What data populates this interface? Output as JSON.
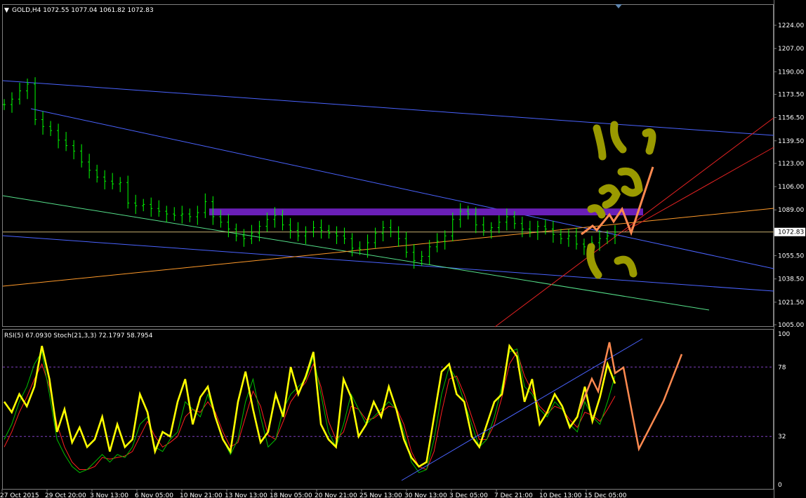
{
  "colors": {
    "background": "#000000",
    "frame": "#7f7f7f",
    "bull_bars": "#00ff00",
    "rsi": "#ffff00",
    "stoch_main": "#00c000",
    "stoch_signal": "#ff2020",
    "channel_blue": "#4a63ff",
    "channel_red": "#e52222",
    "trend_orange": "#ff9a2a",
    "trend_green": "#55e08a",
    "zone_purple": "#6a1fb8",
    "hand_orange": "#ff8a50",
    "hand_yellow": "#9a9a00",
    "price_tag_bg": "#ffffff"
  },
  "header": {
    "arrow": "▼",
    "title": "GOLD,H4  1072.55 1077.04 1061.82 1072.83"
  },
  "indicator_header": {
    "title": "RSI(5) 67.0930  Stoch(21,3,3) 72.1797 58.7954"
  },
  "current_price_label": "1072.83",
  "price_scale": [
    "1224.00",
    "1207.00",
    "1190.00",
    "1173.50",
    "1156.50",
    "1139.50",
    "1123.00",
    "1106.00",
    "1089.00",
    "1072.83",
    "1055.50",
    "1038.50",
    "1021.50",
    "1005.00"
  ],
  "oscillator_scale": [
    "100",
    "78",
    "32",
    "0"
  ],
  "time_labels": [
    "27 Oct 2015",
    "29 Oct 20:00",
    "3 Nov 13:00",
    "6 Nov 05:00",
    "10 Nov 21:00",
    "13 Nov 13:00",
    "18 Nov 05:00",
    "20 Nov 21:00",
    "25 Nov 13:00",
    "30 Nov 13:00",
    "3 Dec 05:00",
    "7 Dec 21:00",
    "10 Dec 13:00",
    "15 Dec 05:00"
  ],
  "chart_data": [
    {
      "type": "candlestick",
      "symbol": "GOLD",
      "timeframe": "H4",
      "ohlc_last": {
        "open": 1072.55,
        "high": 1077.04,
        "low": 1061.82,
        "close": 1072.83
      },
      "ylim": [
        1005.0,
        1234.0
      ],
      "x": [
        "27 Oct 2015",
        "29 Oct 20:00",
        "3 Nov 13:00",
        "6 Nov 05:00",
        "10 Nov 21:00",
        "13 Nov 13:00",
        "18 Nov 05:00",
        "20 Nov 21:00",
        "25 Nov 13:00",
        "30 Nov 13:00",
        "3 Dec 05:00",
        "7 Dec 21:00",
        "10 Dec 13:00",
        "15 Dec 05:00"
      ],
      "close_path": [
        1166,
        1170,
        1176,
        1181,
        1155,
        1150,
        1147,
        1140,
        1136,
        1132,
        1124,
        1118,
        1113,
        1110,
        1108,
        1109,
        1094,
        1092,
        1093,
        1090,
        1088,
        1086,
        1085,
        1086,
        1084,
        1087,
        1095,
        1084,
        1080,
        1075,
        1070,
        1068,
        1072,
        1077,
        1082,
        1085,
        1078,
        1074,
        1070,
        1073,
        1076,
        1074,
        1072,
        1070,
        1068,
        1061,
        1060,
        1065,
        1072,
        1076,
        1073,
        1068,
        1058,
        1052,
        1055,
        1062,
        1066,
        1070,
        1082,
        1088,
        1086,
        1078,
        1074,
        1076,
        1080,
        1084,
        1079,
        1075,
        1073,
        1077,
        1075,
        1071,
        1068,
        1070,
        1064,
        1062,
        1065,
        1068,
        1070,
        1072.83
      ],
      "levels": {
        "resistance_zone": [
          1085,
          1090
        ],
        "current": 1072.83
      }
    },
    {
      "type": "line",
      "title": "RSI(5) 67.0930  Stoch(21,3,3) 72.1797 58.7954",
      "ylim": [
        0,
        100
      ],
      "levels": [
        78,
        32
      ],
      "series": [
        {
          "name": "RSI(5)",
          "values": [
            55,
            48,
            60,
            52,
            65,
            92,
            70,
            35,
            50,
            28,
            38,
            25,
            30,
            45,
            22,
            40,
            25,
            30,
            60,
            48,
            22,
            35,
            32,
            55,
            70,
            40,
            58,
            65,
            45,
            30,
            22,
            55,
            75,
            50,
            28,
            35,
            60,
            45,
            78,
            60,
            72,
            88,
            40,
            30,
            25,
            70,
            58,
            32,
            40,
            55,
            45,
            65,
            50,
            30,
            18,
            12,
            15,
            45,
            75,
            80,
            60,
            55,
            32,
            25,
            40,
            55,
            60,
            92,
            85,
            55,
            70,
            40,
            48,
            60,
            52,
            38,
            45,
            65,
            42,
            58,
            80,
            67.09
          ]
        },
        {
          "name": "Stoch(21,3,3) main",
          "values": [
            30,
            40,
            55,
            65,
            80,
            88,
            60,
            30,
            20,
            12,
            8,
            10,
            15,
            20,
            15,
            20,
            18,
            25,
            40,
            45,
            25,
            22,
            30,
            35,
            55,
            50,
            45,
            60,
            45,
            30,
            20,
            30,
            55,
            70,
            45,
            25,
            30,
            50,
            60,
            65,
            70,
            85,
            60,
            35,
            25,
            40,
            60,
            50,
            40,
            45,
            50,
            55,
            50,
            35,
            15,
            8,
            10,
            30,
            60,
            78,
            70,
            55,
            40,
            25,
            30,
            45,
            65,
            88,
            90,
            65,
            60,
            50,
            45,
            55,
            50,
            40,
            35,
            55,
            45,
            40,
            55,
            72.18
          ]
        },
        {
          "name": "Stoch(21,3,3) signal",
          "values": [
            25,
            35,
            48,
            58,
            70,
            80,
            65,
            40,
            25,
            15,
            10,
            10,
            12,
            18,
            17,
            18,
            19,
            22,
            32,
            42,
            32,
            25,
            28,
            32,
            45,
            50,
            48,
            55,
            48,
            35,
            25,
            28,
            45,
            62,
            52,
            33,
            30,
            42,
            55,
            62,
            68,
            80,
            65,
            42,
            30,
            35,
            52,
            50,
            43,
            44,
            48,
            52,
            51,
            40,
            22,
            12,
            10,
            22,
            48,
            70,
            72,
            60,
            45,
            30,
            30,
            40,
            58,
            80,
            88,
            72,
            62,
            52,
            47,
            52,
            50,
            43,
            38,
            48,
            46,
            42,
            50,
            58.8
          ]
        }
      ]
    }
  ]
}
